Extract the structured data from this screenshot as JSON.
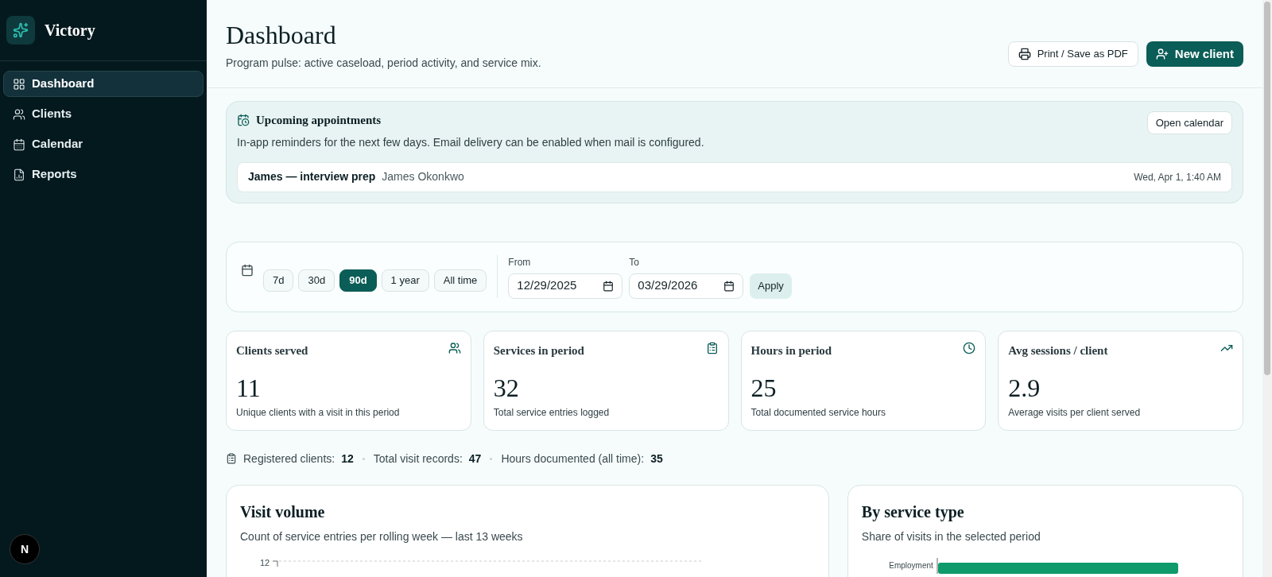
{
  "sidebar": {
    "brand": "Victory",
    "items": [
      {
        "label": "Dashboard",
        "kind": "grid",
        "selected": true
      },
      {
        "label": "Clients",
        "kind": "users",
        "selected": false
      },
      {
        "label": "Calendar",
        "kind": "calendar",
        "selected": false
      },
      {
        "label": "Reports",
        "kind": "report",
        "selected": false
      }
    ],
    "avatar": "N"
  },
  "header": {
    "title": "Dashboard",
    "subtitle": "Program pulse: active caseload, period activity, and service mix.",
    "buttons": [
      {
        "label": "Print / Save as PDF",
        "kind": "outline"
      },
      {
        "label": "New client",
        "kind": "primary"
      }
    ]
  },
  "appointments": {
    "title": "Upcoming appointments",
    "description": "In-app reminders for the next few days. Email delivery can be enabled when mail is configured.",
    "action": "Open calendar",
    "items": [
      {
        "title": "James — interview prep",
        "client": "James Okonkwo",
        "time": "Wed, Apr 1, 1:40 AM"
      }
    ]
  },
  "filters": {
    "ranges": [
      {
        "label": "7d",
        "selected": false
      },
      {
        "label": "30d",
        "selected": false
      },
      {
        "label": "90d",
        "selected": true
      },
      {
        "label": "1 year",
        "selected": false
      },
      {
        "label": "All time",
        "selected": false
      }
    ],
    "from": {
      "label": "From",
      "value": "12/29/2025"
    },
    "to": {
      "label": "To",
      "value": "03/29/2026"
    },
    "apply": "Apply"
  },
  "stats": [
    {
      "title": "Clients served",
      "value": "11",
      "caption": "Unique clients with a visit in this period",
      "kind": "users"
    },
    {
      "title": "Services in period",
      "value": "32",
      "caption": "Total service entries logged",
      "kind": "clipboard"
    },
    {
      "title": "Hours in period",
      "value": "25",
      "caption": "Total documented service hours",
      "kind": "clock"
    },
    {
      "title": "Avg sessions / client",
      "value": "2.9",
      "caption": "Average visits per client served",
      "kind": "trend"
    }
  ],
  "totals": [
    {
      "label": "Registered clients:",
      "value": "12"
    },
    {
      "label": "Total visit records:",
      "value": "47"
    },
    {
      "label": "Hours documented (all time):",
      "value": "35"
    }
  ],
  "panels": [
    {
      "title": "Visit volume",
      "subtitle": "Count of service entries per rolling week — last 13 weeks",
      "kind": "line",
      "visible_label": "12"
    },
    {
      "title": "By service type",
      "subtitle": "Share of visits in the selected period",
      "kind": "bar",
      "visible_label": "Employment"
    }
  ]
}
